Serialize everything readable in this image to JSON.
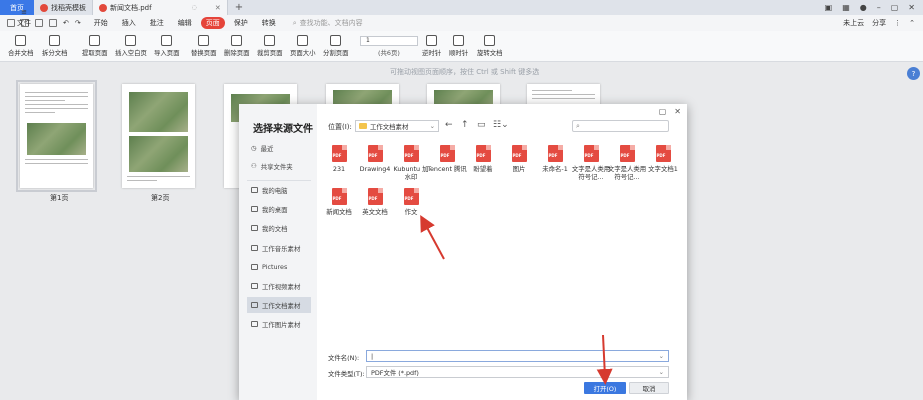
{
  "tabs": {
    "home": "首页",
    "template": "找稻壳模板",
    "document": "新闻文档.pdf"
  },
  "menubar": {
    "file": "文件",
    "items": [
      "开始",
      "插入",
      "批注",
      "编辑",
      "页面",
      "保护",
      "转换"
    ],
    "active": "页面",
    "search_placeholder": "查找功能、文档内容",
    "uncloud": "未上云",
    "share": "分享"
  },
  "ribbon": {
    "buttons": [
      {
        "label": "合并文档",
        "icon": "merge-doc-icon"
      },
      {
        "label": "拆分文档",
        "icon": "split-doc-icon"
      },
      {
        "label": "提取页面",
        "icon": "extract-page-icon"
      },
      {
        "label": "插入空白页",
        "icon": "insert-blank-page-icon"
      },
      {
        "label": "导入页面",
        "icon": "import-page-icon"
      },
      {
        "label": "替换页面",
        "icon": "replace-page-icon"
      },
      {
        "label": "删除页面",
        "icon": "delete-page-icon"
      },
      {
        "label": "裁剪页面",
        "icon": "crop-page-icon"
      },
      {
        "label": "页面大小",
        "icon": "page-size-icon"
      },
      {
        "label": "分割页面",
        "icon": "split-page-icon"
      },
      {
        "label": "逆时针",
        "icon": "rotate-ccw-icon"
      },
      {
        "label": "顺时针",
        "icon": "rotate-cw-icon"
      },
      {
        "label": "旋转文档",
        "icon": "rotate-doc-icon"
      }
    ],
    "page_input": "1",
    "page_total": "(共6页)"
  },
  "workspace": {
    "hint": "可拖动视图页面顺序，按住 Ctrl 或 Shift 键多选",
    "help": "?",
    "thumbnails": [
      {
        "label": "第1页"
      },
      {
        "label": "第2页"
      },
      {
        "label": ""
      },
      {
        "label": ""
      },
      {
        "label": ""
      },
      {
        "label": ""
      }
    ]
  },
  "dialog": {
    "title": "选择来源文件",
    "sidebar": [
      {
        "label": "最近",
        "icon": "clock-icon"
      },
      {
        "label": "共享文件夹",
        "icon": "shared-folder-icon"
      },
      {
        "label": "我的电脑",
        "icon": "computer-icon"
      },
      {
        "label": "我的桌面",
        "icon": "desktop-icon"
      },
      {
        "label": "我的文档",
        "icon": "documents-icon"
      },
      {
        "label": "工作音乐素材",
        "icon": "folder-icon"
      },
      {
        "label": "Pictures",
        "icon": "folder-icon"
      },
      {
        "label": "工作视频素材",
        "icon": "folder-icon"
      },
      {
        "label": "工作文档素材",
        "icon": "folder-icon"
      },
      {
        "label": "工作图片素材",
        "icon": "folder-icon"
      }
    ],
    "selected_sidebar": "工作文档素材",
    "location_label": "位置(I):",
    "location_value": "工作文档素材",
    "files": [
      "231",
      "Drawing4",
      "Kubuntu 加水印",
      "Tencent 腾讯",
      "盼望着",
      "图片",
      "未命名-1",
      "文字是人类用符号记...",
      "文字是人类用符号记...",
      "文字文档1",
      "新闻文档",
      "英文文档",
      "作文"
    ],
    "pdf_badge": "PDF",
    "filename_label": "文件名(N):",
    "filename_value": "|",
    "filetype_label": "文件类型(T):",
    "filetype_value": "PDF文件 (*.pdf)",
    "open_button": "打开(O)",
    "cancel_button": "取消"
  },
  "annotation_color": "#d63a2f"
}
